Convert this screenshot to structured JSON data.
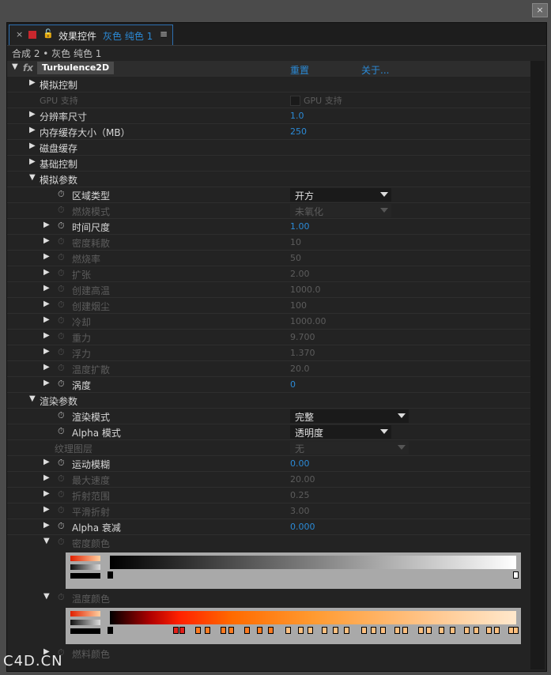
{
  "window": {
    "close": "×"
  },
  "tab": {
    "close": "×",
    "lock": "🔓",
    "title": "效果控件",
    "layer": "灰色 纯色 1",
    "menu": "≡"
  },
  "breadcrumb": "合成 2 • 灰色 纯色 1",
  "effect": {
    "name": "Turbulence2D",
    "reset": "重置",
    "about": "关于..."
  },
  "rows": {
    "sim_control": "模拟控制",
    "gpu_label": "GPU 支持",
    "gpu_check": "GPU 支持",
    "res_label": "分辨率尺寸",
    "res_value": "1.0",
    "mem_label": "内存缓存大小（MB）",
    "mem_value": "250",
    "disk_cache": "磁盘缓存",
    "basic_control": "基础控制",
    "sim_params": "模拟参数",
    "domain_type": "区域类型",
    "domain_value": "开方",
    "burn_mode": "燃烧模式",
    "burn_value": "未氧化",
    "time_scale": "时间尺度",
    "time_value": "1.00",
    "density_diss": "密度耗散",
    "density_diss_value": "10",
    "burn_rate": "燃烧率",
    "burn_rate_value": "50",
    "expand": "扩张",
    "expand_value": "2.00",
    "create_heat": "创建高温",
    "create_heat_value": "1000.0",
    "create_smoke": "创建烟尘",
    "create_smoke_value": "100",
    "cooling": "冷却",
    "cooling_value": "1000.00",
    "gravity": "重力",
    "gravity_value": "9.700",
    "buoyancy": "浮力",
    "buoyancy_value": "1.370",
    "temp_diff": "温度扩散",
    "temp_diff_value": "20.0",
    "vorticity": "涡度",
    "vorticity_value": "0",
    "render_params": "渲染参数",
    "render_mode": "渲染模式",
    "render_mode_value": "完整",
    "alpha_mode": "Alpha 模式",
    "alpha_mode_value": "透明度",
    "texture_layer": "纹理图层",
    "texture_value": "无",
    "motion_blur": "运动模糊",
    "motion_blur_value": "0.00",
    "max_speed": "最大速度",
    "max_speed_value": "20.00",
    "refract_range": "折射范围",
    "refract_range_value": "0.25",
    "smooth_refract": "平滑折射",
    "smooth_refract_value": "3.00",
    "alpha_decay": "Alpha 衰减",
    "alpha_decay_value": "0.000",
    "density_color": "密度颜色",
    "temp_color": "温度颜色",
    "fuel_color": "燃料颜色"
  },
  "colors": {
    "accent": "#2b8ad6",
    "bg": "#232323",
    "tab_red": "#c8272d"
  },
  "watermark": "C4D.CN"
}
